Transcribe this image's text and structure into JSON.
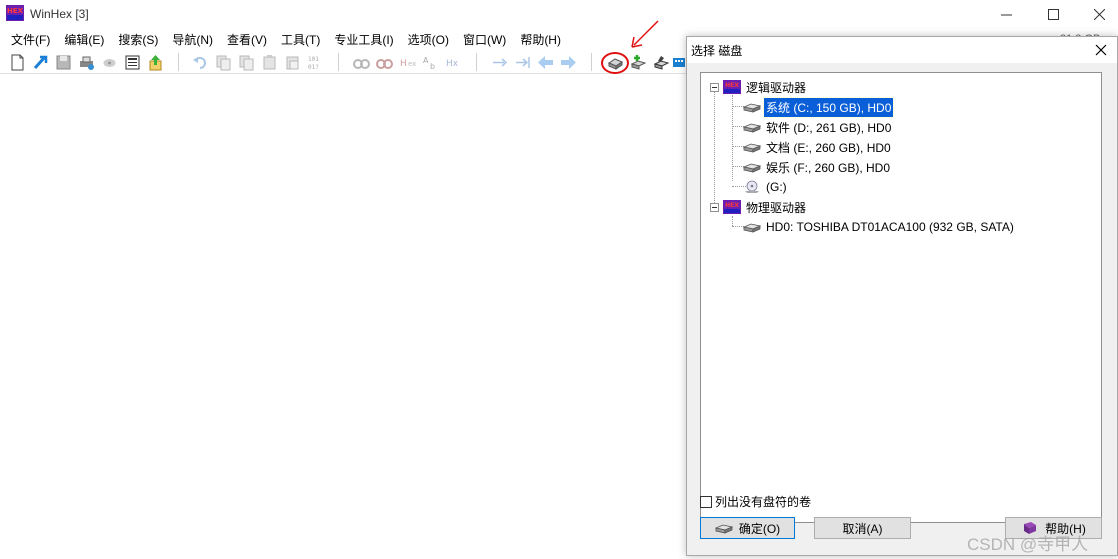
{
  "window": {
    "title": "WinHex [3]",
    "status_right": "21.3 GB ↑"
  },
  "menu": [
    {
      "label": "文件(F)"
    },
    {
      "label": "编辑(E)"
    },
    {
      "label": "搜索(S)"
    },
    {
      "label": "导航(N)"
    },
    {
      "label": "查看(V)"
    },
    {
      "label": "工具(T)"
    },
    {
      "label": "专业工具(I)"
    },
    {
      "label": "选项(O)"
    },
    {
      "label": "窗口(W)"
    },
    {
      "label": "帮助(H)"
    }
  ],
  "toolbar": {
    "icons": [
      "new-file-icon",
      "open-icon",
      "save-icon",
      "print-icon",
      "revert-icon",
      "properties-icon",
      "export-icon",
      "undo-icon",
      "cut-icon",
      "copy-icon",
      "paste-icon",
      "paste-special-icon",
      "hex-convert-icon",
      "find-text-icon",
      "find-hex-icon",
      "replace-text-icon",
      "replace-hex-icon",
      "goto-offset-icon",
      "goto-sector-icon",
      "back-icon",
      "forward-icon",
      "open-disk-icon",
      "ram-editor-icon",
      "disk-tools-icon",
      "calculator-icon"
    ]
  },
  "dialog": {
    "title": "选择 磁盘",
    "logical_group": "逻辑驱动器",
    "logical_drives": [
      {
        "label": "系统 (C:, 150 GB), HD0",
        "selected": true
      },
      {
        "label": "软件 (D:, 261 GB), HD0",
        "selected": false
      },
      {
        "label": "文档 (E:, 260 GB), HD0",
        "selected": false
      },
      {
        "label": "娱乐 (F:, 260 GB), HD0",
        "selected": false
      },
      {
        "label": "(G:)",
        "selected": false
      }
    ],
    "physical_group": "物理驱动器",
    "physical_drives": [
      {
        "label": "HD0: TOSHIBA DT01ACA100 (932 GB, SATA)"
      }
    ],
    "checkbox_label": "列出没有盘符的卷",
    "ok_label": "确定(O)",
    "cancel_label": "取消(A)",
    "help_label": "帮助(H)"
  },
  "watermark": "CSDN @寺甲人",
  "colors": {
    "selection": "#0a5fd8",
    "annotation_red": "#e01010"
  }
}
